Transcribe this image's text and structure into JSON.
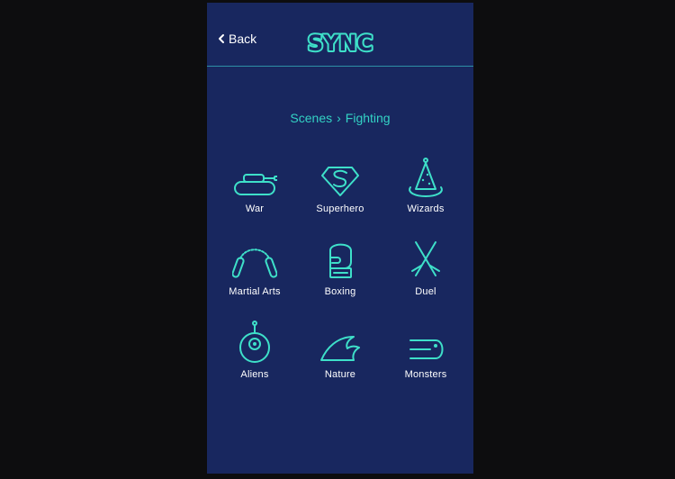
{
  "header": {
    "back_label": "Back",
    "logo_text": "SYNC",
    "accent_color": "#3ee0c9"
  },
  "breadcrumb": {
    "parent": "Scenes",
    "separator": "›",
    "current": "Fighting"
  },
  "scenes": [
    {
      "label": "War",
      "icon": "tank-icon"
    },
    {
      "label": "Superhero",
      "icon": "superhero-emblem-icon"
    },
    {
      "label": "Wizards",
      "icon": "wizard-hat-icon"
    },
    {
      "label": "Martial Arts",
      "icon": "nunchucks-icon"
    },
    {
      "label": "Boxing",
      "icon": "boxing-glove-icon"
    },
    {
      "label": "Duel",
      "icon": "crossed-swords-icon"
    },
    {
      "label": "Aliens",
      "icon": "alien-icon"
    },
    {
      "label": "Nature",
      "icon": "wave-icon"
    },
    {
      "label": "Monsters",
      "icon": "monster-icon"
    }
  ],
  "colors": {
    "background": "#0d0d0f",
    "panel": "#18275f",
    "accent": "#3ee0c9",
    "text": "#ffffff"
  }
}
